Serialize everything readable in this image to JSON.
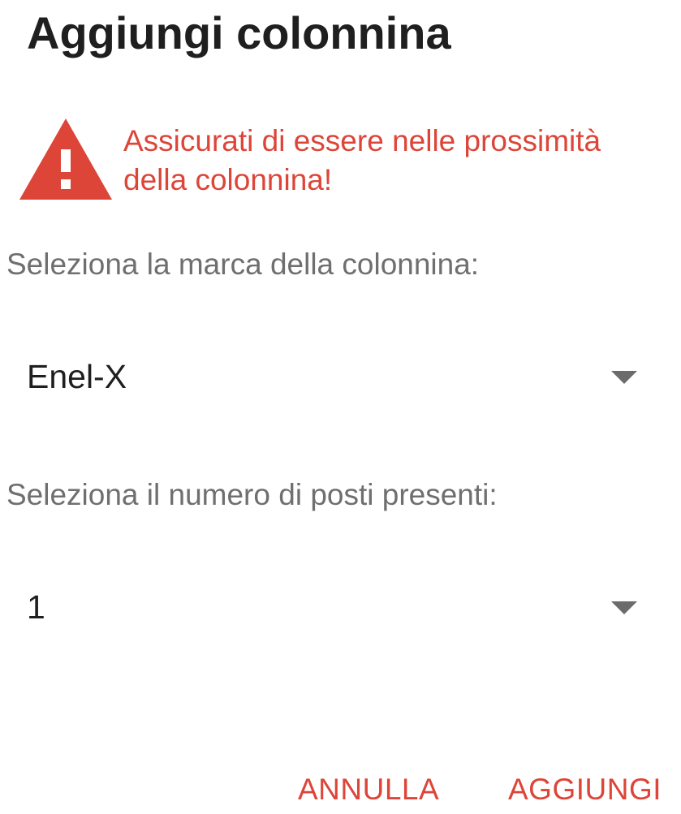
{
  "dialog": {
    "title": "Aggiungi colonnina"
  },
  "warning": {
    "icon": "warning-triangle-icon",
    "line1": "Assicurati di essere nelle prossimità",
    "line2": "della colonnina!",
    "color": "#dd4539"
  },
  "brand_field": {
    "label": "Seleziona la marca della colonnina:",
    "selected_value": "Enel-X"
  },
  "spots_field": {
    "label": "Seleziona il numero di posti presenti:",
    "selected_value": "1"
  },
  "actions": {
    "cancel_label": "ANNULLA",
    "add_label": "AGGIUNGI"
  },
  "colors": {
    "accent": "#dd4539",
    "title_text": "#1f1f1f",
    "label_text": "#6f6f6f"
  }
}
